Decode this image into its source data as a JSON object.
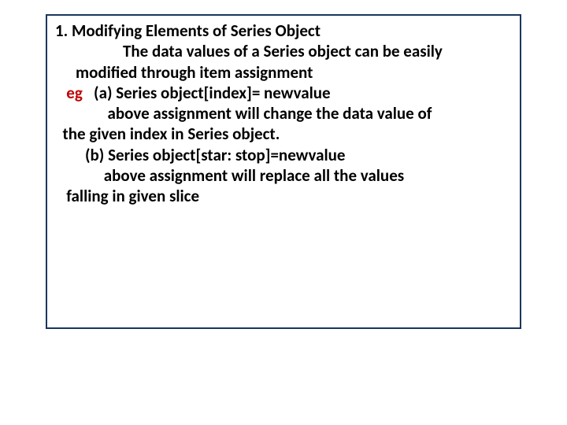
{
  "slide": {
    "section1": {
      "number": "1.",
      "title": "Modifying Elements of Series Object",
      "line2a": "The  data values of a Series object can be easily",
      "line2b": "modified through item assignment"
    },
    "example": {
      "label": "eg",
      "a": {
        "head": "(a) Series object[index]=  newvalue",
        "line2": "above assignment will change the data value of",
        "line3": "the given index in Series object."
      },
      "b": {
        "head": "(b) Series object[star: stop]=newvalue",
        "line2": "above assignment will replace all the values",
        "line3": "falling in given slice"
      }
    }
  }
}
